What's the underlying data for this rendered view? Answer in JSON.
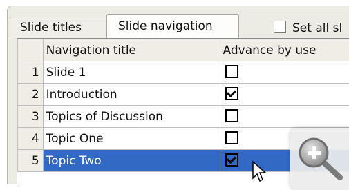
{
  "tabs": [
    {
      "label": "Slide titles"
    },
    {
      "label": "Slide navigation"
    }
  ],
  "set_all_label": "Set all sl",
  "grid": {
    "headers": [
      "Navigation title",
      "Advance by use"
    ],
    "rows": [
      {
        "num": "1",
        "title": "Slide 1",
        "advance_checked": false,
        "selected": false
      },
      {
        "num": "2",
        "title": "Introduction",
        "advance_checked": true,
        "selected": false
      },
      {
        "num": "3",
        "title": "Topics of Discussion",
        "advance_checked": false,
        "selected": false
      },
      {
        "num": "4",
        "title": "Topic One",
        "advance_checked": false,
        "selected": false
      },
      {
        "num": "5",
        "title": "Topic Two",
        "advance_checked": true,
        "selected": true
      }
    ]
  },
  "colors": {
    "selection": "#3169c5",
    "tab_background": "#ecebe4"
  },
  "icons": {
    "zoom": "magnifier-plus-icon",
    "cursor": "arrow-cursor-icon"
  }
}
